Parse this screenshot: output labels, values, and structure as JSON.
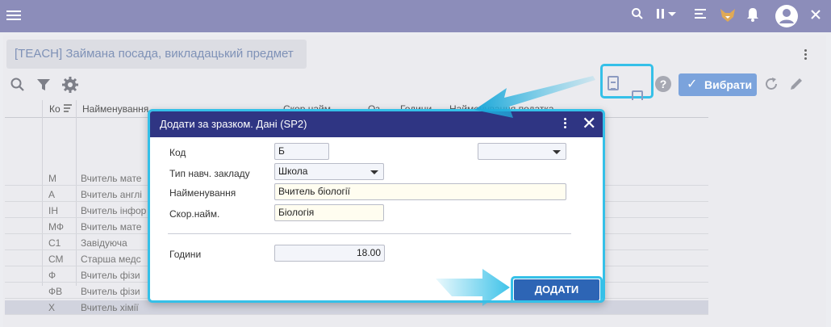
{
  "panel": {
    "title": "[TEACH] Займана посада, викладацький предмет"
  },
  "toolbar": {
    "select_label": "Вибрати"
  },
  "table": {
    "headers": {
      "code": "Ко",
      "name": "Найменування",
      "short": "Скор.найм.",
      "oz": "Оз",
      "hours": "Години",
      "extra": "Найменування податка"
    },
    "rows": [
      {
        "code": "М",
        "name": "Вчитель мате",
        "selected": false
      },
      {
        "code": "А",
        "name": "Вчитель англі",
        "selected": false
      },
      {
        "code": "ІН",
        "name": "Вчитель інфор",
        "selected": false
      },
      {
        "code": "МФ",
        "name": "Вчитель мате",
        "selected": false
      },
      {
        "code": "С1",
        "name": "Завідуюча",
        "selected": false
      },
      {
        "code": "СМ",
        "name": "Старша медс",
        "selected": false
      },
      {
        "code": "Ф",
        "name": "Вчитель фізи",
        "selected": false
      },
      {
        "code": "ФВ",
        "name": "Вчитель фізи",
        "selected": false
      },
      {
        "code": "Х",
        "name": "Вчитель хімії",
        "selected": true
      }
    ]
  },
  "dialog": {
    "title": "Додати за зразком. Дані (SP2)",
    "fields": {
      "code_label": "Код",
      "code_value": "Б",
      "school_type_label": "Тип навч. закладу",
      "school_type_value": "Школа",
      "name_label": "Найменування",
      "name_value": "Вчитель біології",
      "short_label": "Скор.найм.",
      "short_value": "Біологія",
      "hours_label": "Години",
      "hours_value": "18.00"
    },
    "add_label": "ДОДАТИ"
  },
  "colors": {
    "accent": "#35c0e8",
    "header": "#2f3583",
    "topbar": "#8c8dba",
    "button": "#2d65b5"
  }
}
